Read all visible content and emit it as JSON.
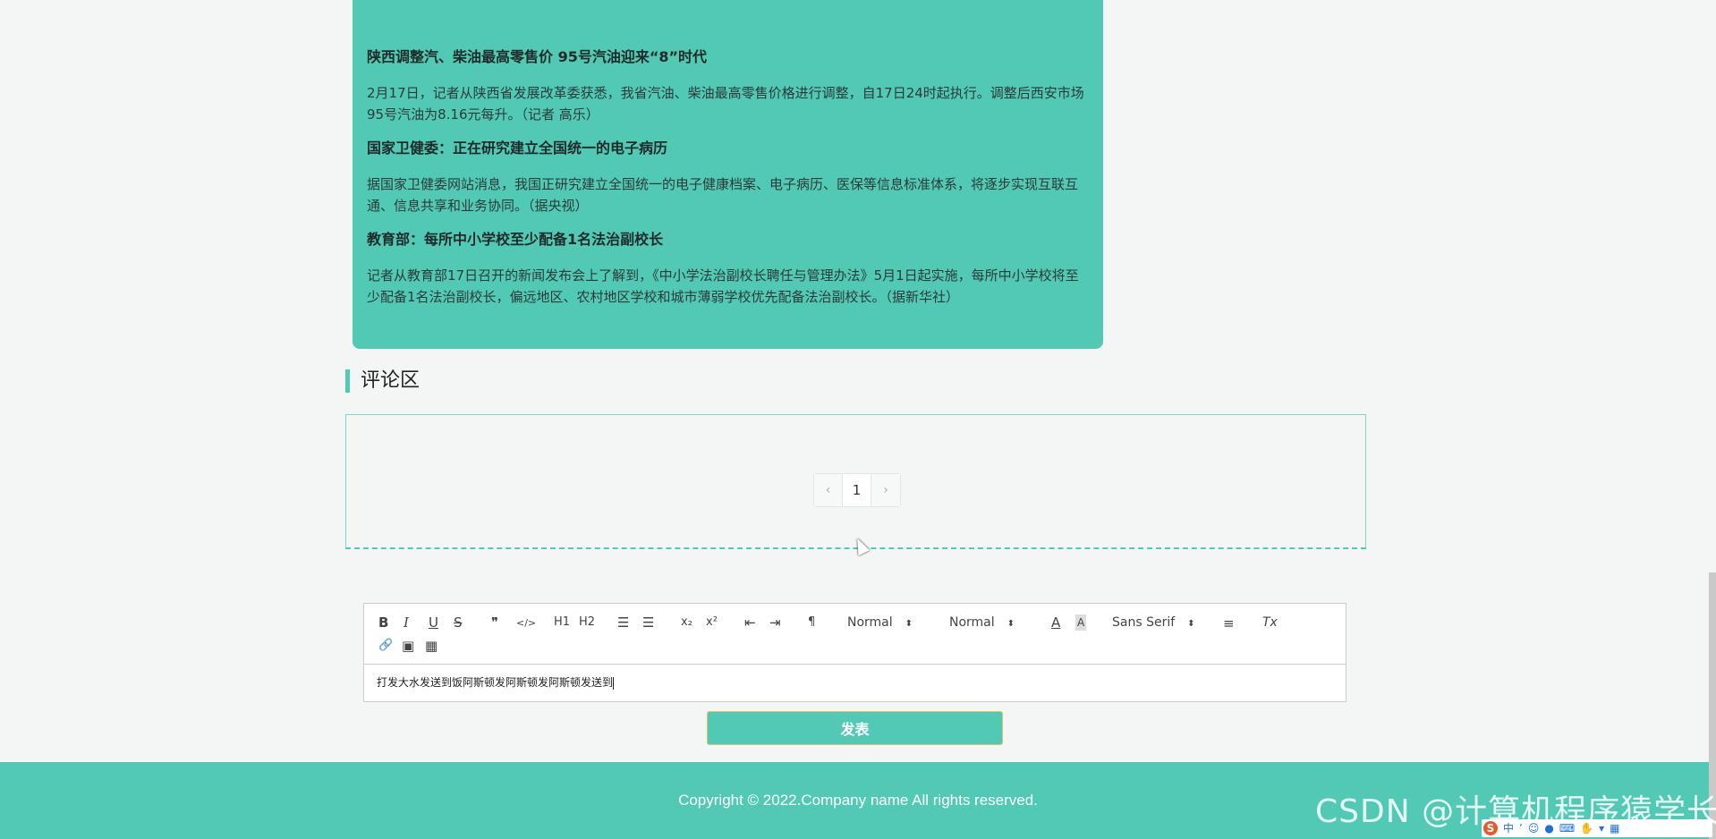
{
  "news": [
    {
      "title": "陕西调整汽、柴油最高零售价 95号汽油迎来“8”时代",
      "body": "2月17日，记者从陕西省发展改革委获悉，我省汽油、柴油最高零售价格进行调整，自17日24时起执行。调整后西安市场95号汽油为8.16元每升。（记者 高乐）"
    },
    {
      "title": "国家卫健委：正在研究建立全国统一的电子病历",
      "body": "据国家卫健委网站消息，我国正研究建立全国统一的电子健康档案、电子病历、医保等信息标准体系，将逐步实现互联互通、信息共享和业务协同。（据央视）"
    },
    {
      "title": "教育部：每所中小学校至少配备1名法治副校长",
      "body": "记者从教育部17日召开的新闻发布会上了解到，《中小学法治副校长聘任与管理办法》5月1日起实施，每所中小学校将至少配备1名法治副校长，偏远地区、农村地区学校和城市薄弱学校优先配备法治副校长。（据新华社）"
    }
  ],
  "comments": {
    "heading": "评论区",
    "pagination": {
      "prev": "‹",
      "current": "1",
      "next": "›"
    }
  },
  "editor": {
    "toolbar": {
      "bold": "B",
      "italic": "I",
      "underline": "U",
      "strike": "S",
      "blockquote": "❞",
      "code": "</>",
      "h1": "H1",
      "h2": "H2",
      "ordered_list": "☰",
      "bullet_list": "☰",
      "subscript": "x₂",
      "superscript": "x²",
      "outdent": "⇤",
      "indent": "⇥",
      "direction": "¶",
      "size_select": "Normal",
      "header_select": "Normal",
      "font_select": "Sans Serif",
      "align": "≡",
      "clean": "Tx",
      "link": "🔗",
      "image": "▣",
      "video": "▦"
    },
    "content": "打发大水发送到饭阿斯顿发阿斯顿发阿斯顿发送到"
  },
  "submit_label": "发表",
  "footer": {
    "copyright": "Copyright © 2022.Company name All rights reserved."
  },
  "watermark": "CSDN @计算机程序猿学长",
  "ime": {
    "logo": "S",
    "mode": "中"
  },
  "colors": {
    "accent": "#52c9b5",
    "page_bg": "#f4f6f6"
  }
}
